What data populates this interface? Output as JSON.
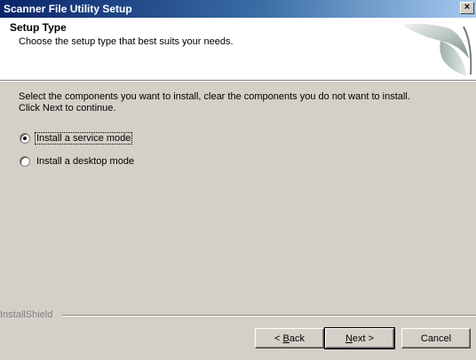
{
  "window": {
    "title": "Scanner File Utility Setup",
    "close_label": "×"
  },
  "header": {
    "title": "Setup Type",
    "subtitle": "Choose the setup type that best suits your needs."
  },
  "body": {
    "instruction_line1": "Select the components you want to install, clear the components you do not want to install.",
    "instruction_line2": "Click Next to continue.",
    "options": [
      {
        "label": "Install a service mode",
        "selected": true
      },
      {
        "label": "Install a desktop mode",
        "selected": false
      }
    ]
  },
  "footer": {
    "brand": "InstallShield",
    "back_prefix": "< ",
    "back_accel": "B",
    "back_rest": "ack",
    "next_accel": "N",
    "next_rest": "ext >",
    "cancel_label": "Cancel"
  },
  "colors": {
    "title_bar_start": "#0a246a",
    "title_bar_end": "#a6caf0",
    "dialog_face": "#d4d0c8"
  }
}
